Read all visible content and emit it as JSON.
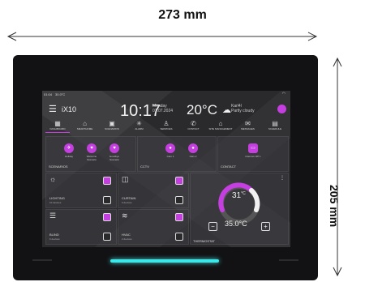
{
  "dimensions": {
    "width_label": "273 mm",
    "height_label": "205 mm"
  },
  "screen": {
    "status": {
      "time": "01:04",
      "temp": "30.0°C"
    },
    "header": {
      "app_name": "iX10",
      "time": "10:17",
      "day": "Monday",
      "date": "01.07.2024",
      "temperature": "20°C",
      "location": "Karl4l",
      "condition": "Partly cloudy"
    },
    "nav": [
      {
        "icon": "dashboard-icon",
        "label": "DASHBOARD"
      },
      {
        "icon": "home-icon",
        "label": "SMARTHOME"
      },
      {
        "icon": "scenario-icon",
        "label": "SCENARIOS"
      },
      {
        "icon": "alarm-icon",
        "label": "ALARM"
      },
      {
        "icon": "services-icon",
        "label": "SERVICES"
      },
      {
        "icon": "contact-icon",
        "label": "CONTACT"
      },
      {
        "icon": "site-icon",
        "label": "SITE MANAGEMENT"
      },
      {
        "icon": "message-icon",
        "label": "MESSAGES"
      },
      {
        "icon": "calendar-icon",
        "label": "SCHEDULE"
      }
    ],
    "scenarios": {
      "label": "SCENARIOS",
      "items": [
        "Holiday",
        "Welcome Scenario",
        "Goodbye Scenario"
      ]
    },
    "cctv": {
      "label": "CCTV",
      "items": [
        "Cam 1",
        "Cam 2"
      ]
    },
    "contact": {
      "label": "CONTACT",
      "items": [
        "Intercom DP 1"
      ]
    },
    "lighting": {
      "label": "LIGHTING",
      "sub": "10 devices"
    },
    "curtain": {
      "label": "CURTAIN",
      "sub": "6 devices"
    },
    "blind": {
      "label": "BLIND",
      "sub": "6 devices"
    },
    "hvac": {
      "label": "HVAC",
      "sub": "2 devices"
    },
    "thermostat": {
      "label": "THERMOSTAT",
      "current": "31",
      "unit": "°C",
      "setpoint": "35.0°C",
      "minus": "−",
      "plus": "+"
    },
    "colors": {
      "accent": "#c53ee0",
      "led": "#3fe6e8"
    }
  }
}
